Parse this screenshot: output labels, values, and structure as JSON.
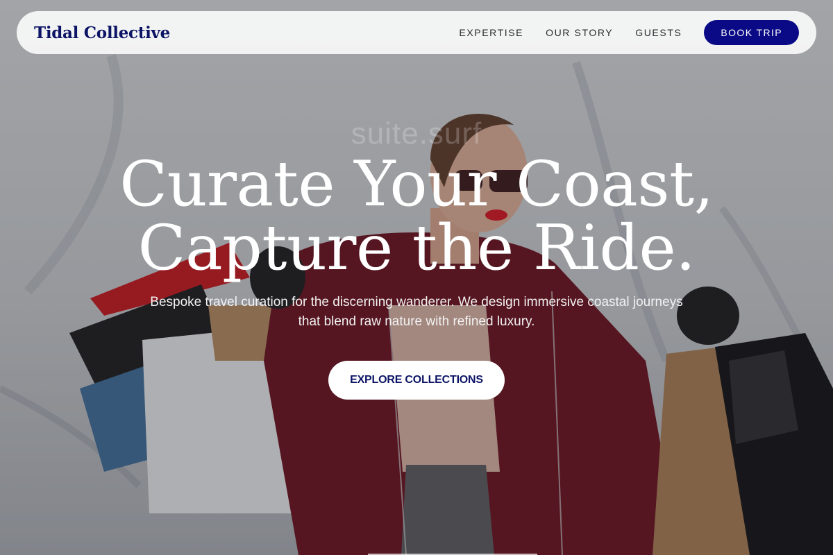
{
  "navbar": {
    "brand": "Tidal Collective",
    "links": [
      "EXPERTISE",
      "OUR STORY",
      "GUESTS"
    ],
    "book_label": "BOOK TRIP"
  },
  "hero": {
    "headline_line1": "Curate Your Coast,",
    "headline_line2": "Capture the Ride.",
    "watermark": "suite.surf",
    "subtext_line1": "Bespoke travel curation for the discerning wanderer. We design immersive coastal journeys",
    "subtext_line2": "that blend raw nature with refined luxury.",
    "cta_label": "EXPLORE COLLECTIONS"
  },
  "colors": {
    "brand": "#0c1466",
    "book_button": "#0a0a86",
    "nav_background": "#f6f6f6",
    "headline": "#ffffff"
  }
}
